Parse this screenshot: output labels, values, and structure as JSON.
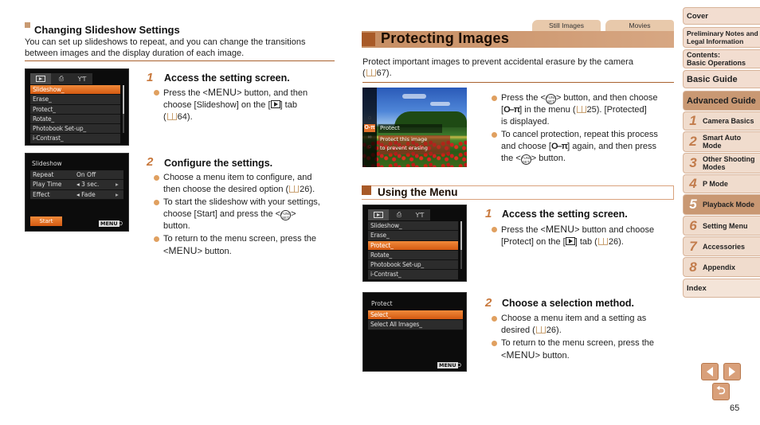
{
  "left_section": {
    "title": "Changing Slideshow Settings",
    "intro_line1": "You can set up slideshows to repeat, and you can change the transitions",
    "intro_line2": "between images and the display duration of each image.",
    "menu_screen": {
      "items": [
        "Slideshow_",
        "Erase_",
        "Protect_",
        "Rotate_",
        "Photobook Set-up_",
        "i-Contrast_"
      ],
      "selected": "Slideshow_"
    },
    "slideshow_screen": {
      "title": "Slideshow",
      "rows": [
        {
          "label": "Repeat",
          "value": "On  Off"
        },
        {
          "label": "Play Time",
          "value": "◂ 3 sec.",
          "arrow": "▸"
        },
        {
          "label": "Effect",
          "value": "◂ Fade",
          "arrow": "▸"
        }
      ],
      "start_label": "Start",
      "menu_badge": "MENU",
      "back_glyph": "⮌"
    },
    "step1": {
      "num": "1",
      "title": "Access the setting screen.",
      "b1_a": "Press the <",
      "b1_menu": "MENU",
      "b1_b": "> button, and then",
      "b1_c": "choose [Slideshow] on the [",
      "b1_d": "] tab",
      "b1_e": "(",
      "b1_f": "64)."
    },
    "step2": {
      "num": "2",
      "title": "Configure the settings.",
      "b1_a": "Choose a menu item to configure, and",
      "b1_b": "then choose the desired option (",
      "b1_c": "26).",
      "b2_a": "To start the slideshow with your settings,",
      "b2_b": "choose [Start] and press the <",
      "b2_c": ">",
      "b2_d": "button.",
      "b3_a": "To return to the menu screen, press the",
      "b3_b": "<",
      "b3_menu": "MENU",
      "b3_c": "> button."
    }
  },
  "right_section": {
    "tabs": [
      "Still Images",
      "Movies"
    ],
    "title": "Protecting Images",
    "intro_line1": "Protect important images to prevent accidental erasure by the camera",
    "intro_line2_a": "(",
    "intro_line2_b": "67).",
    "photo_overlay": {
      "label": "Protect",
      "desc_line1": "Protect this image",
      "desc_line2": "to prevent erasing"
    },
    "bullets": {
      "b1_a": "Press the <",
      "b1_b": "> button, and then choose",
      "b1_c": "[",
      "b1_key": "O–π",
      "b1_d": "] in the menu (",
      "b1_e": "25). [Protected]",
      "b1_f": "is displayed.",
      "b2_a": "To cancel protection, repeat this process",
      "b2_b": "and choose [",
      "b2_key": "O–π",
      "b2_c": "] again, and then press",
      "b2_d": "the <",
      "b2_e": "> button."
    },
    "subsection_title": "Using the Menu",
    "menu_screen": {
      "items": [
        "Slideshow_",
        "Erase_",
        "Protect_",
        "Rotate_",
        "Photobook Set-up_",
        "i-Contrast_"
      ],
      "selected": "Protect_"
    },
    "protect_screen": {
      "title": "Protect",
      "items": [
        "Select_",
        "Select All Images_"
      ],
      "selected": "Select_",
      "menu_badge": "MENU",
      "back_glyph": "⮌"
    },
    "step1": {
      "num": "1",
      "title": "Access the setting screen.",
      "b1_a": "Press the <",
      "b1_menu": "MENU",
      "b1_b": "> button and choose",
      "b1_c": "[Protect] on the [",
      "b1_d": "] tab (",
      "b1_e": "26)."
    },
    "step2": {
      "num": "2",
      "title": "Choose a selection method.",
      "b1_a": "Choose a menu item and a setting as",
      "b1_b": "desired (",
      "b1_c": "26).",
      "b2_a": "To return to the menu screen, press the",
      "b2_b": "<",
      "b2_menu": "MENU",
      "b2_c": "> button."
    }
  },
  "sidebar": {
    "cover": "Cover",
    "prelim_1": "Preliminary Notes and",
    "prelim_2": "Legal Information",
    "contents_1": "Contents:",
    "contents_2": "Basic Operations",
    "basic_guide": "Basic Guide",
    "advanced_guide": "Advanced Guide",
    "chapters": [
      {
        "num": "1",
        "label": "Camera Basics"
      },
      {
        "num": "2",
        "label": "Smart Auto Mode"
      },
      {
        "num": "3",
        "label": "Other Shooting Modes"
      },
      {
        "num": "4",
        "label": "P Mode"
      },
      {
        "num": "5",
        "label": "Playback Mode"
      },
      {
        "num": "6",
        "label": "Setting Menu"
      },
      {
        "num": "7",
        "label": "Accessories"
      },
      {
        "num": "8",
        "label": "Appendix"
      }
    ],
    "active_chapter": "5",
    "index": "Index"
  },
  "page_number": "65",
  "colors": {
    "accent": "#c99873",
    "title_dark_square": "#a85a28",
    "bullet": "#e0a060",
    "menu_selected": "#e0702a"
  }
}
